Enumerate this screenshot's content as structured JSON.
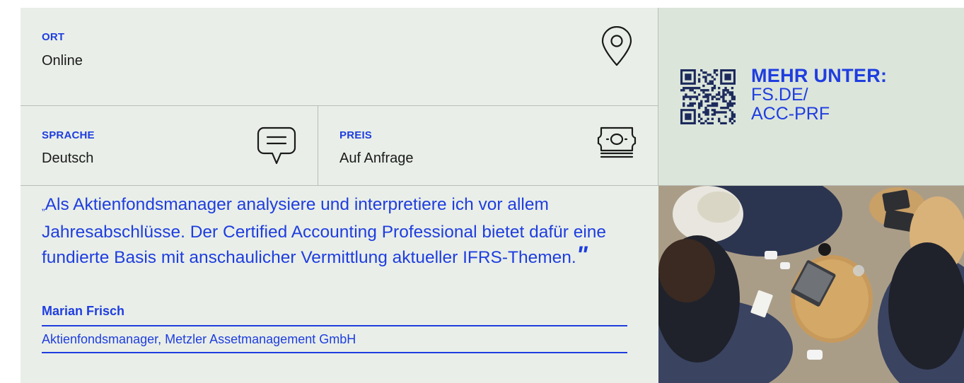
{
  "details": {
    "ort": {
      "label": "ORT",
      "value": "Online",
      "icon": "map-pin-icon"
    },
    "sprache": {
      "label": "SPRACHE",
      "value": "Deutsch",
      "icon": "speech-bubble-icon"
    },
    "preis": {
      "label": "PREIS",
      "value": "Auf Anfrage",
      "icon": "banknote-icon"
    }
  },
  "promo": {
    "title": "MEHR UNTER:",
    "url_line1": "FS.DE/",
    "url_line2": "ACC-PRF",
    "icon": "qr-code-icon"
  },
  "testimonial": {
    "open_mark": "„",
    "quote": "Als Aktienfondsmanager analysiere und interpretiere ich vor allem Jahresabschlüsse. Der Certified Accounting Professional bietet dafür eine fundierte Basis mit anschaulicher Vermittlung aktueller IFRS-Themen.",
    "close_mark": "\"",
    "author": "Marian Frisch",
    "role": "Aktienfondsmanager, Metzler Assetmanagement GmbH"
  },
  "colors": {
    "accent": "#1f3de0",
    "panel_bg": "#e9efe8",
    "promo_bg": "#dbe5da",
    "qr": "#1d2a5c"
  }
}
